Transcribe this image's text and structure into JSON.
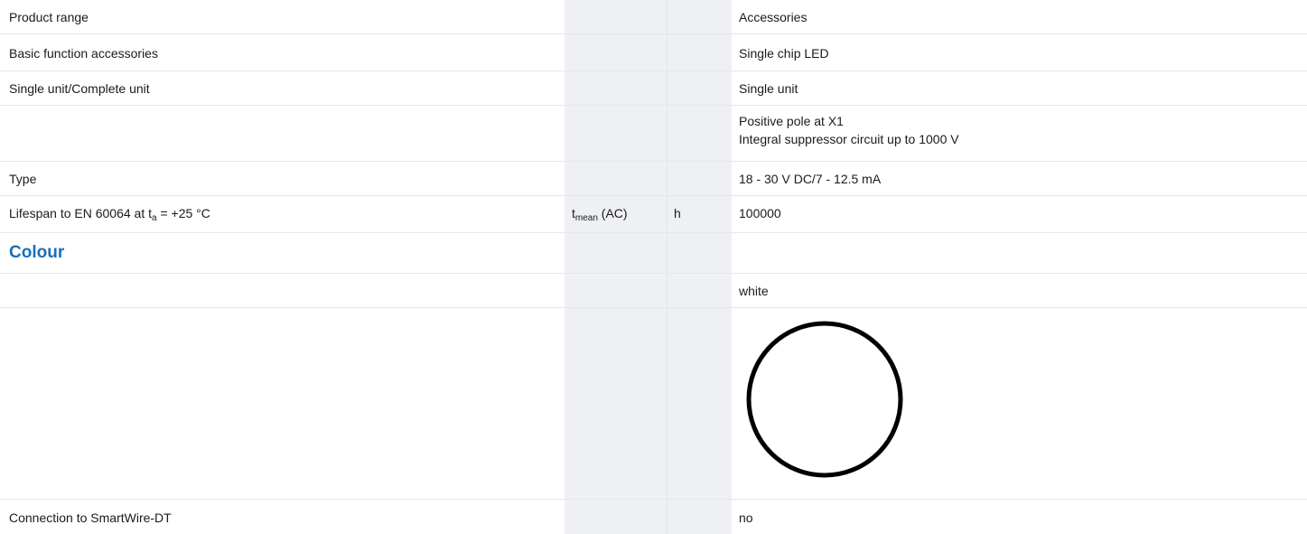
{
  "rows": {
    "product_range": {
      "label": "Product range",
      "value": "Accessories"
    },
    "basic_function": {
      "label": "Basic function accessories",
      "value": "Single chip LED"
    },
    "unit": {
      "label": "Single unit/Complete unit",
      "value": "Single unit"
    },
    "notes": {
      "label": "",
      "value_line1": "Positive pole at X1",
      "value_line2": "Integral suppressor circuit up to 1000 V"
    },
    "type": {
      "label": "Type",
      "value": "18 - 30 V DC/7 - 12.5 mA"
    },
    "lifespan": {
      "label_prefix": "Lifespan to EN 60064 at t",
      "label_sub": "a",
      "label_suffix": " = +25 °C",
      "symbol_main": "t",
      "symbol_sub": "mean",
      "symbol_suffix": " (AC)",
      "unit": "h",
      "value": "100000"
    },
    "colour_heading": {
      "label": "Colour"
    },
    "colour": {
      "label": "",
      "value": "white"
    },
    "colour_swatch": {
      "icon": "white-circle-swatch-icon",
      "color": "#ffffff",
      "stroke": "#000000"
    },
    "smartwire": {
      "label": "Connection to SmartWire-DT",
      "value": "no"
    }
  }
}
